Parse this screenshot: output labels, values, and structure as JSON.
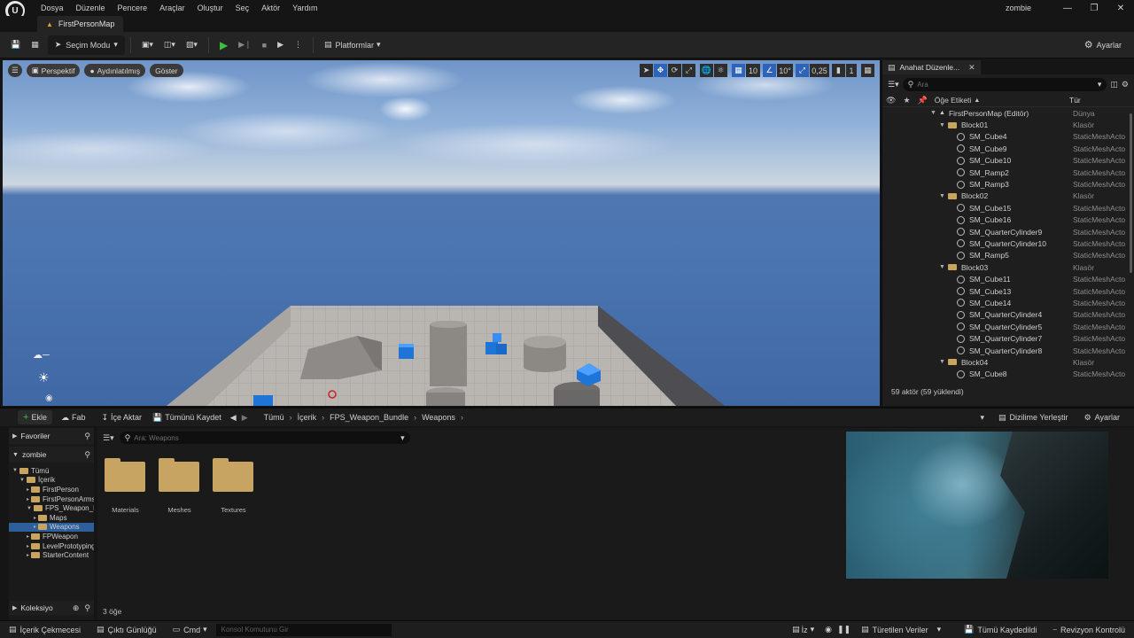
{
  "menubar": {
    "logo": "unreal-logo",
    "items": [
      "Dosya",
      "Düzenle",
      "Pencere",
      "Araçlar",
      "Oluştur",
      "Seç",
      "Aktör",
      "Yardım"
    ],
    "project": "zombie",
    "window_controls": [
      "minimize-icon",
      "restore-icon",
      "close-icon"
    ]
  },
  "tab": {
    "label": "FirstPersonMap"
  },
  "toolbar": {
    "selection_mode": "Seçim Modu",
    "platforms": "Platformlar",
    "settings": "Ayarlar"
  },
  "viewport": {
    "perspective": "Perspektif",
    "lit": "Aydınlatılmış",
    "show": "Göster",
    "grid_snap": "10",
    "angle_snap": "10°",
    "scale_snap": "0,25",
    "camera_speed": "1"
  },
  "outliner": {
    "tab_title": "Anahat Düzenle...",
    "search_placeholder": "Ara",
    "col_label": "Öğe Etiketi",
    "col_type": "Tür",
    "rows": [
      {
        "label": "FirstPersonMap (Editör)",
        "type": "Dünya",
        "kind": "world",
        "depth": 0
      },
      {
        "label": "Block01",
        "type": "Klasör",
        "kind": "folder",
        "depth": 1
      },
      {
        "label": "SM_Cube4",
        "type": "StaticMeshActo",
        "kind": "mesh",
        "depth": 2
      },
      {
        "label": "SM_Cube9",
        "type": "StaticMeshActo",
        "kind": "mesh",
        "depth": 2
      },
      {
        "label": "SM_Cube10",
        "type": "StaticMeshActo",
        "kind": "mesh",
        "depth": 2
      },
      {
        "label": "SM_Ramp2",
        "type": "StaticMeshActo",
        "kind": "mesh",
        "depth": 2
      },
      {
        "label": "SM_Ramp3",
        "type": "StaticMeshActo",
        "kind": "mesh",
        "depth": 2
      },
      {
        "label": "Block02",
        "type": "Klasör",
        "kind": "folder",
        "depth": 1
      },
      {
        "label": "SM_Cube15",
        "type": "StaticMeshActo",
        "kind": "mesh",
        "depth": 2
      },
      {
        "label": "SM_Cube16",
        "type": "StaticMeshActo",
        "kind": "mesh",
        "depth": 2
      },
      {
        "label": "SM_QuarterCylinder9",
        "type": "StaticMeshActo",
        "kind": "mesh",
        "depth": 2
      },
      {
        "label": "SM_QuarterCylinder10",
        "type": "StaticMeshActo",
        "kind": "mesh",
        "depth": 2
      },
      {
        "label": "SM_Ramp5",
        "type": "StaticMeshActo",
        "kind": "mesh",
        "depth": 2
      },
      {
        "label": "Block03",
        "type": "Klasör",
        "kind": "folder",
        "depth": 1
      },
      {
        "label": "SM_Cube11",
        "type": "StaticMeshActo",
        "kind": "mesh",
        "depth": 2
      },
      {
        "label": "SM_Cube13",
        "type": "StaticMeshActo",
        "kind": "mesh",
        "depth": 2
      },
      {
        "label": "SM_Cube14",
        "type": "StaticMeshActo",
        "kind": "mesh",
        "depth": 2
      },
      {
        "label": "SM_QuarterCylinder4",
        "type": "StaticMeshActo",
        "kind": "mesh",
        "depth": 2
      },
      {
        "label": "SM_QuarterCylinder5",
        "type": "StaticMeshActo",
        "kind": "mesh",
        "depth": 2
      },
      {
        "label": "SM_QuarterCylinder7",
        "type": "StaticMeshActo",
        "kind": "mesh",
        "depth": 2
      },
      {
        "label": "SM_QuarterCylinder8",
        "type": "StaticMeshActo",
        "kind": "mesh",
        "depth": 2
      },
      {
        "label": "Block04",
        "type": "Klasör",
        "kind": "folder",
        "depth": 1
      },
      {
        "label": "SM_Cube8",
        "type": "StaticMeshActo",
        "kind": "mesh",
        "depth": 2
      }
    ],
    "status": "59 aktör (59 yüklendi)"
  },
  "content_browser": {
    "add": "Ekle",
    "fab": "Fab",
    "import": "İçe Aktar",
    "save_all": "Tümünü Kaydet",
    "breadcrumb": [
      "Tümü",
      "İçerik",
      "FPS_Weapon_Bundle",
      "Weapons"
    ],
    "dock_layout": "Dizilime Yerleştir",
    "settings": "Ayarlar",
    "favorites": "Favoriler",
    "project_root": "zombie",
    "tree": [
      {
        "label": "Tümü",
        "depth": 0
      },
      {
        "label": "İçerik",
        "depth": 1
      },
      {
        "label": "FirstPerson",
        "depth": 2
      },
      {
        "label": "FirstPersonArms",
        "depth": 2
      },
      {
        "label": "FPS_Weapon_Bundle",
        "depth": 2
      },
      {
        "label": "Maps",
        "depth": 3
      },
      {
        "label": "Weapons",
        "depth": 3,
        "selected": true
      },
      {
        "label": "FPWeapon",
        "depth": 2
      },
      {
        "label": "LevelPrototyping",
        "depth": 2
      },
      {
        "label": "StarterContent",
        "depth": 2
      }
    ],
    "collections": "Koleksiyo",
    "search_placeholder": "Ara: Weapons",
    "folders": [
      "Materials",
      "Meshes",
      "Textures"
    ],
    "item_count": "3 öğe"
  },
  "statusbar": {
    "content_drawer": "İçerik Çekmecesi",
    "output_log": "Çıktı Günlüğü",
    "cmd": "Cmd",
    "console_placeholder": "Konsol Komutunu Gir",
    "trace": "İz",
    "derived_data": "Türetilen Veriler",
    "all_saved": "Tümü Kaydedildi",
    "revision_control": "Revizyon Kontrolü"
  }
}
